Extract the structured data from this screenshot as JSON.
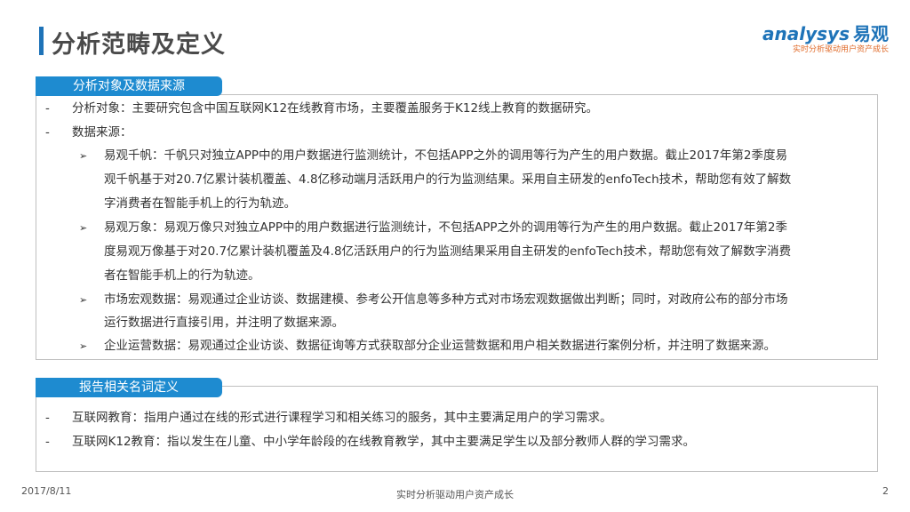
{
  "header": {
    "title": "分析范畴及定义"
  },
  "logo": {
    "brand": "analysys",
    "brand_cn": "易观",
    "tagline": "实时分析驱动用户资产成长"
  },
  "section1": {
    "tab_label": "分析对象及数据来源",
    "item1": {
      "bullet": "-",
      "text": "分析对象：主要研究包含中国互联网K12在线教育市场，主要覆盖服务于K12线上教育的数据研究。"
    },
    "item2": {
      "bullet": "-",
      "text": "数据来源："
    },
    "sub1": {
      "bullet": "➢",
      "line1": "易观千帆：千帆只对独立APP中的用户数据进行监测统计，不包括APP之外的调用等行为产生的用户数据。截止2017年第2季度易",
      "line2": "观千帆基于对20.7亿累计装机覆盖、4.8亿移动端月活跃用户的行为监测结果。采用自主研发的enfoTech技术，帮助您有效了解数",
      "line3": "字消费者在智能手机上的行为轨迹。"
    },
    "sub2": {
      "bullet": "➢",
      "line1": "易观万象：易观万像只对独立APP中的用户数据进行监测统计，不包括APP之外的调用等行为产生的用户数据。截止2017年第2季",
      "line2": "度易观万像基于对20.7亿累计装机覆盖及4.8亿活跃用户的行为监测结果采用自主研发的enfoTech技术，帮助您有效了解数字消费",
      "line3": "者在智能手机上的行为轨迹。"
    },
    "sub3": {
      "bullet": "➢",
      "line1": "市场宏观数据：易观通过企业访谈、数据建模、参考公开信息等多种方式对市场宏观数据做出判断；同时，对政府公布的部分市场",
      "line2": "运行数据进行直接引用，并注明了数据来源。"
    },
    "sub4": {
      "bullet": "➢",
      "line1": "企业运营数据：易观通过企业访谈、数据征询等方式获取部分企业运营数据和用户相关数据进行案例分析，并注明了数据来源。"
    }
  },
  "section2": {
    "tab_label": "报告相关名词定义",
    "item1": {
      "bullet": "-",
      "text": "互联网教育：指用户通过在线的形式进行课程学习和相关练习的服务，其中主要满足用户的学习需求。"
    },
    "item2": {
      "bullet": "-",
      "text": "互联网K12教育：指以发生在儿童、中小学年龄段的在线教育教学，其中主要满足学生以及部分教师人群的学习需求。"
    }
  },
  "watermark": {
    "text": "Analysys 易观"
  },
  "footer": {
    "date": "2017/8/11",
    "slogan": "实时分析驱动用户资产成长",
    "page": "2"
  }
}
